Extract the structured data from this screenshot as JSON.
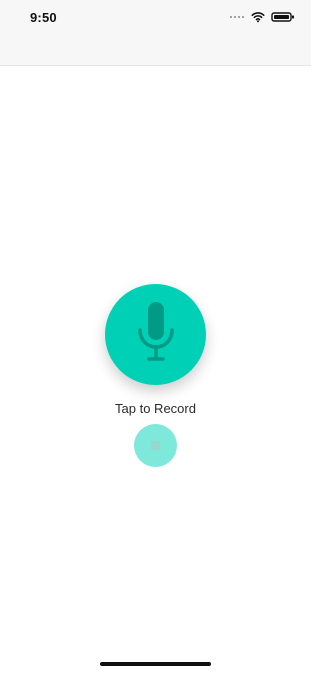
{
  "status_bar": {
    "time": "9:50",
    "icons": [
      "signal-dots-icon",
      "wifi-icon",
      "battery-icon"
    ]
  },
  "main": {
    "record_label": "Tap to Record",
    "record_icon": "microphone-icon",
    "stop_icon": "stop-icon"
  },
  "colors": {
    "accent": "#00d1b6",
    "accent_light": "#7ee8db",
    "background": "#ffffff"
  }
}
